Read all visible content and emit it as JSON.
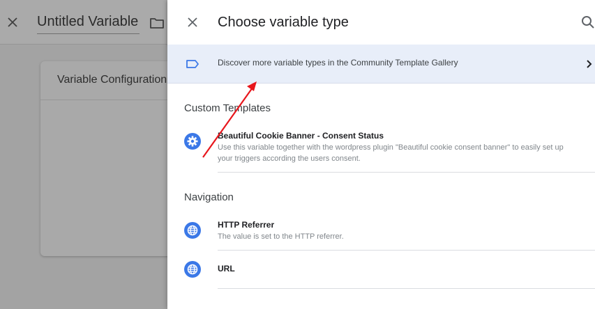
{
  "background": {
    "variable_name": "Untitled Variable",
    "config_card_title": "Variable Configuration"
  },
  "panel": {
    "title": "Choose variable type",
    "gallery_banner": "Discover more variable types in the Community Template Gallery",
    "sections": [
      {
        "title": "Custom Templates",
        "items": [
          {
            "icon": "gear-icon",
            "title": "Beautiful Cookie Banner - Consent Status",
            "description": "Use this variable together with the wordpress plugin \"Beautiful cookie consent banner\" to easily set up your triggers according the users consent."
          }
        ]
      },
      {
        "title": "Navigation",
        "items": [
          {
            "icon": "globe-icon",
            "title": "HTTP Referrer",
            "description": "The value is set to the HTTP referrer."
          },
          {
            "icon": "globe-icon",
            "title": "URL",
            "description": ""
          }
        ]
      }
    ]
  },
  "colors": {
    "accent_blue": "#3b78e7",
    "banner_bg": "#e8eef9",
    "annotation_arrow": "#e8161c"
  }
}
